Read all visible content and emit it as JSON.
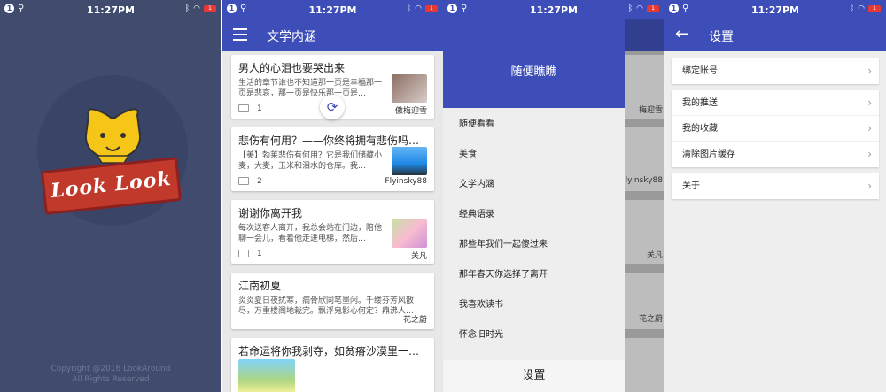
{
  "status": {
    "time": "11:27PM",
    "badge": "1",
    "battery": "1"
  },
  "splash": {
    "logo_text": "Look Look",
    "copyright_line1": "Copyright @2016 LookAround",
    "copyright_line2": "All Rights Reserved"
  },
  "feed": {
    "title": "文学内涵",
    "cards": [
      {
        "title": "男人的心泪也要哭出来",
        "summary": "生活的章节谁也不知道那一页是幸福那一页是悲哀，那一页是快乐那一页是…",
        "count": "1",
        "author": "傲梅迎雪"
      },
      {
        "title": "悲伤有何用？——你终将拥有悲伤吗…",
        "summary": "【美】勃莱悲伤有何用？它是我们储藏小麦，大麦，玉米和泪水的仓库。我…",
        "count": "2",
        "author": "Flyinsky88"
      },
      {
        "title": "谢谢你离开我",
        "summary": "每次送客人离开，我总会站在门边，陪他聊一会儿，看着他走进电梯，然后…",
        "count": "1",
        "author": "关凡"
      },
      {
        "title": "江南初夏",
        "summary": "炎炎夏日夜扰寒，病骨欣同笔墨闲。千缕芬芳风散尽，万重楼阁地栽完。飘浮鬼影心何定？鼎沸人…",
        "count": "",
        "author": "花之蔚"
      },
      {
        "title": "若命运将你我剥夺，如贫瘠沙漠里一…",
        "summary": "",
        "count": "",
        "author": ""
      }
    ]
  },
  "drawer": {
    "title": "随便瞧瞧",
    "items": [
      "随便看看",
      "美食",
      "文学内涵",
      "经典语录",
      "那些年我们一起傻过来",
      "那年春天你选择了离开",
      "我喜欢读书",
      "怀念旧时光"
    ],
    "settings": "设置",
    "peek_texts": [
      "梅迎雪",
      "Flyinsky88",
      "关凡",
      "花之蔚"
    ]
  },
  "settings": {
    "title": "设置",
    "groups": [
      [
        "绑定账号"
      ],
      [
        "我的推送",
        "我的收藏",
        "清除图片缓存"
      ],
      [
        "关于"
      ]
    ]
  },
  "colors": {
    "primary": "#3e4eb8",
    "splash_bg": "#404b6e"
  }
}
